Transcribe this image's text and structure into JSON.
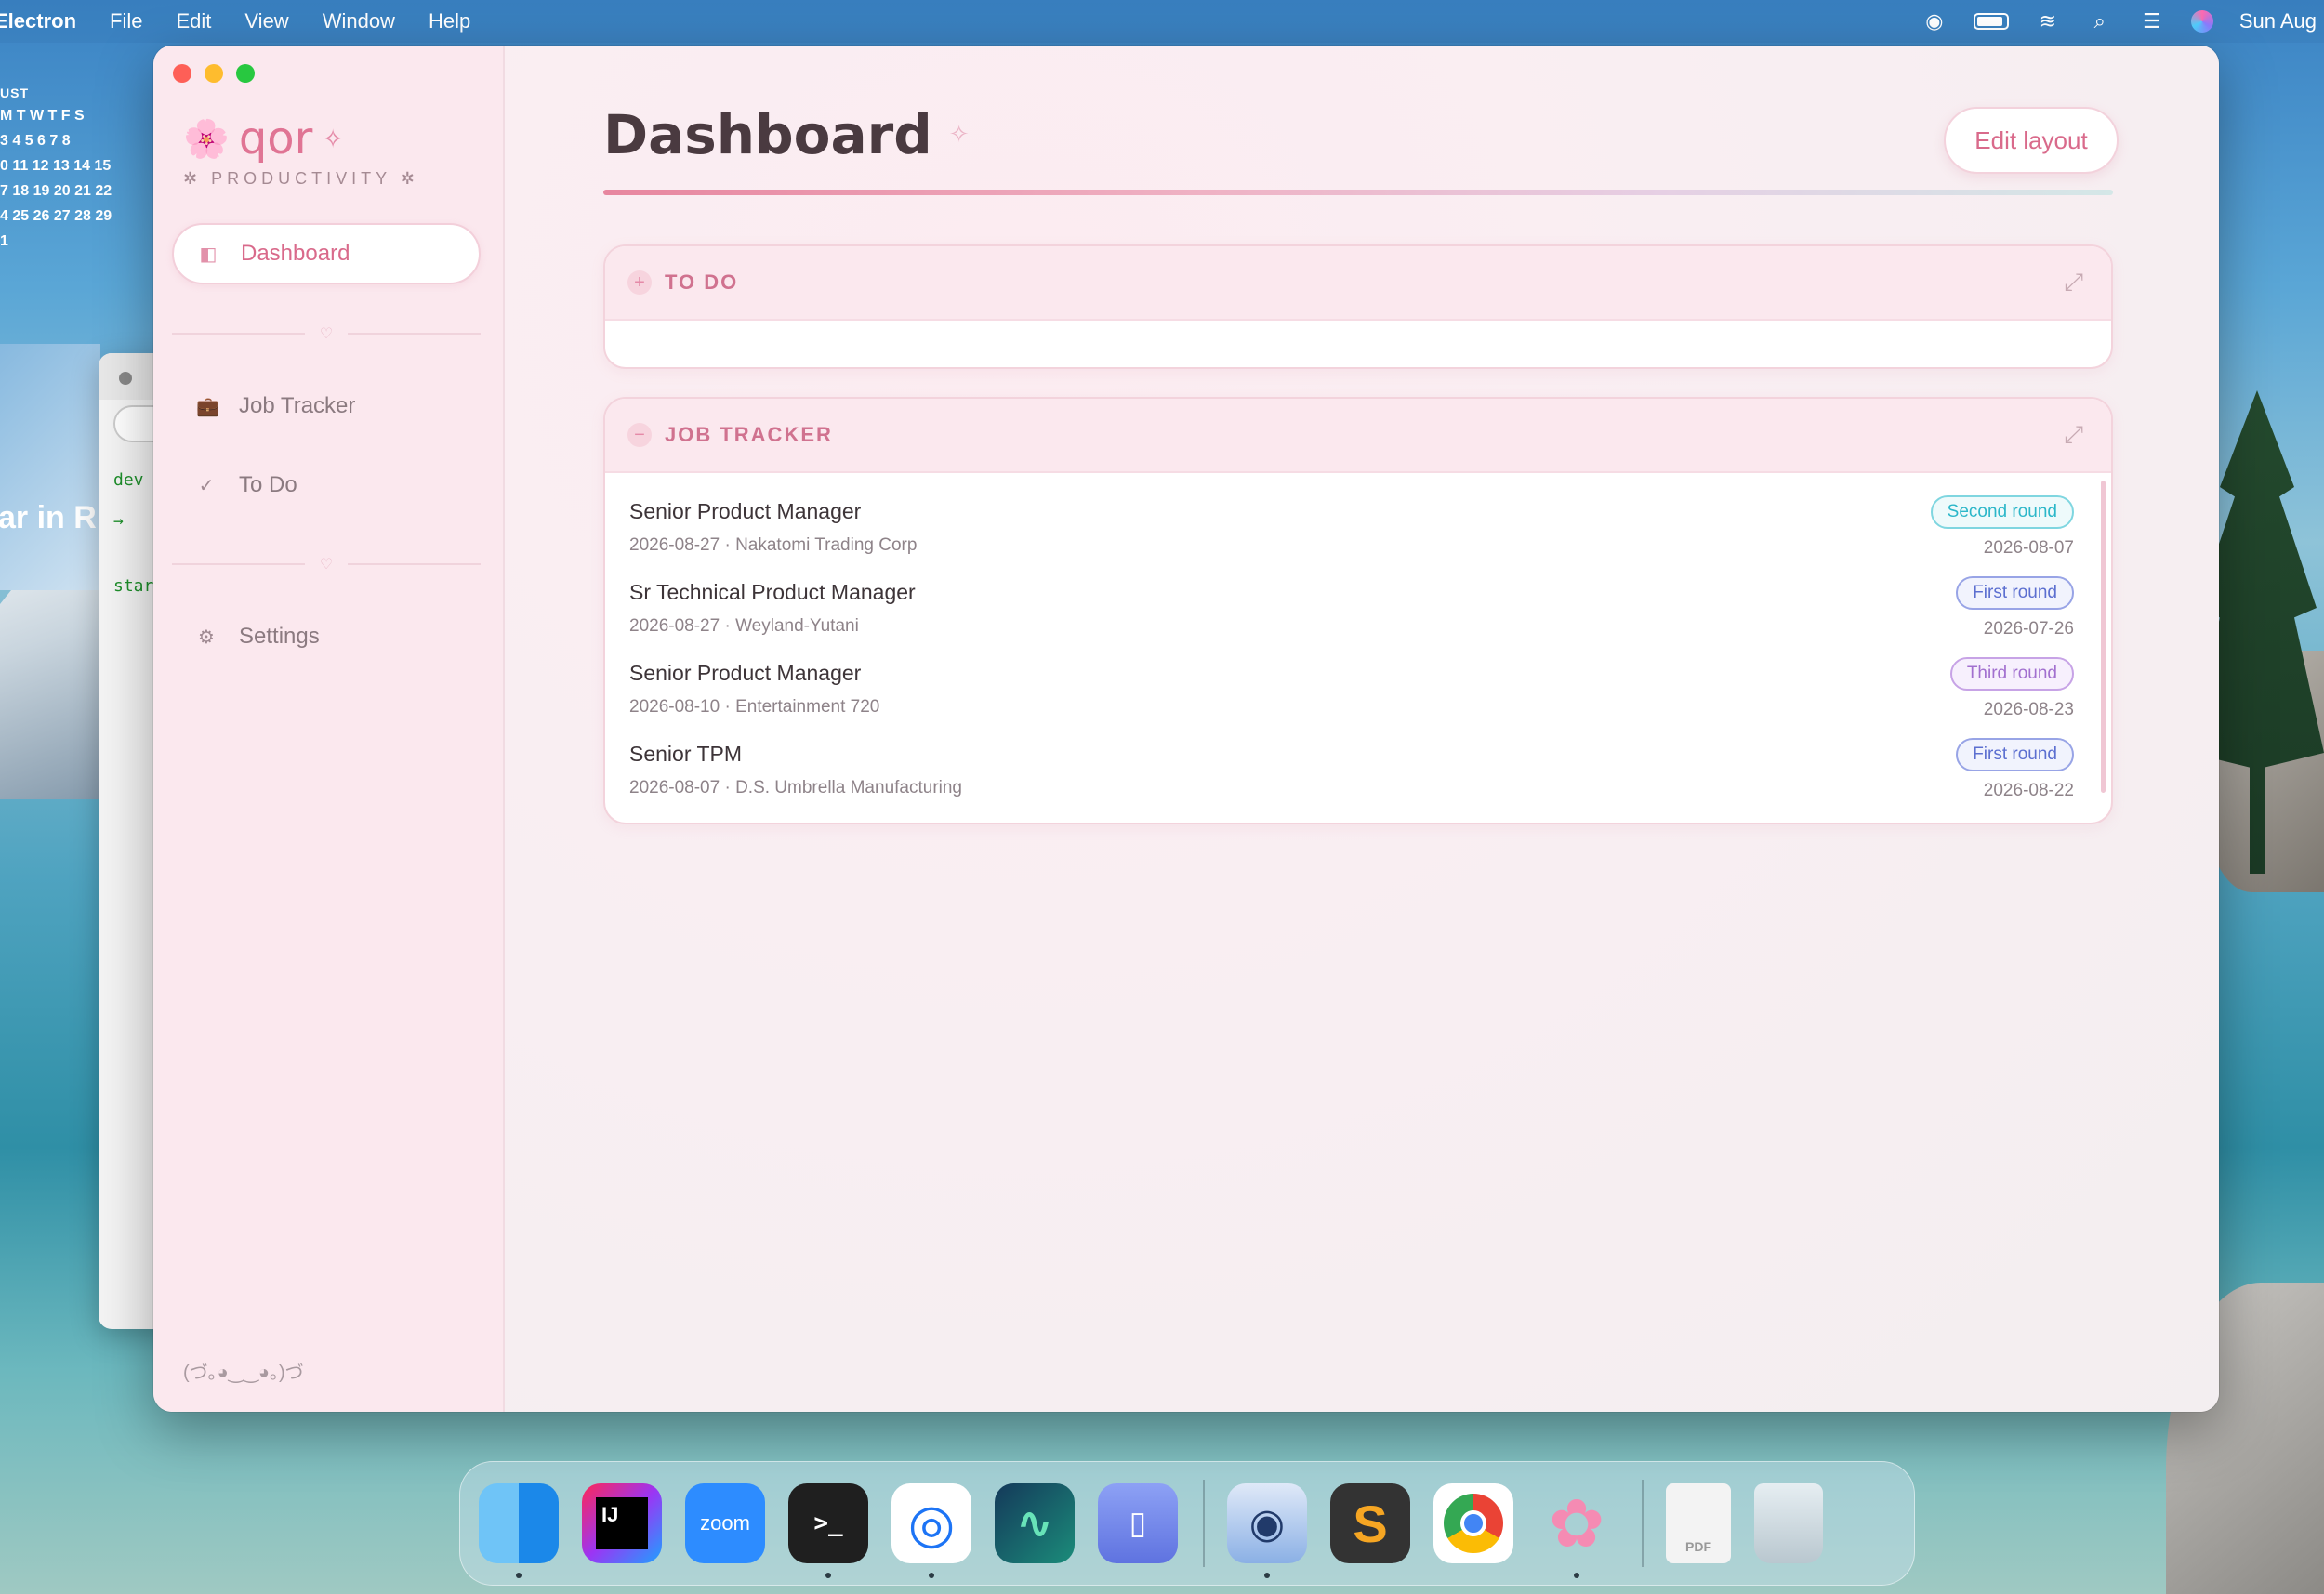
{
  "menubar": {
    "app": "Electron",
    "items": [
      "File",
      "Edit",
      "View",
      "Window",
      "Help"
    ],
    "clock": "Sun Aug"
  },
  "calendar_widget": {
    "month": "UST",
    "rows": [
      "M T W T F S",
      "3 4 5 6 7 8",
      "0 11 12 13 14 15",
      "7 18 19 20 21 22",
      "4 25 26 27 28 29",
      "1"
    ]
  },
  "background_terminal": {
    "lines": [
      "dev",
      "→",
      "star"
    ]
  },
  "background_card_text": "ar in R",
  "sidebar": {
    "brand_flower": "🌸",
    "brand_name": "qor",
    "brand_spark": "✧",
    "tagline": "✲ PRODUCTIVITY ✲",
    "items": [
      {
        "label": "Dashboard",
        "icon": "◧"
      },
      {
        "label": "Job Tracker",
        "icon": "💼"
      },
      {
        "label": "To Do",
        "icon": "✓"
      },
      {
        "label": "Settings",
        "icon": "⚙"
      }
    ],
    "separator_glyph": "♡",
    "kaomoji": "(づ｡◕‿‿◕｡)づ"
  },
  "main": {
    "title": "Dashboard",
    "title_spark": "✧",
    "edit_button": "Edit layout",
    "todo_card": {
      "label": "TO DO",
      "toggle": "+"
    },
    "job_card": {
      "label": "JOB TRACKER",
      "toggle": "−",
      "jobs": [
        {
          "title": "Senior Product Manager",
          "meta": "2026-08-27 · Nakatomi Trading Corp",
          "status": "Second round",
          "date": "2026-08-07"
        },
        {
          "title": "Sr Technical Product Manager",
          "meta": "2026-08-27 · Weyland-Yutani",
          "status": "First round",
          "date": "2026-07-26"
        },
        {
          "title": "Senior Product Manager",
          "meta": "2026-08-10 · Entertainment 720",
          "status": "Third round",
          "date": "2026-08-23"
        },
        {
          "title": "Senior TPM",
          "meta": "2026-08-07 · D.S. Umbrella Manufacturing",
          "status": "First round",
          "date": "2026-08-22"
        }
      ]
    }
  },
  "dock": {
    "zoom_label": "zoom",
    "ij_label": "IJ",
    "terminal_label": ">_",
    "pdf_label": "PDF"
  }
}
